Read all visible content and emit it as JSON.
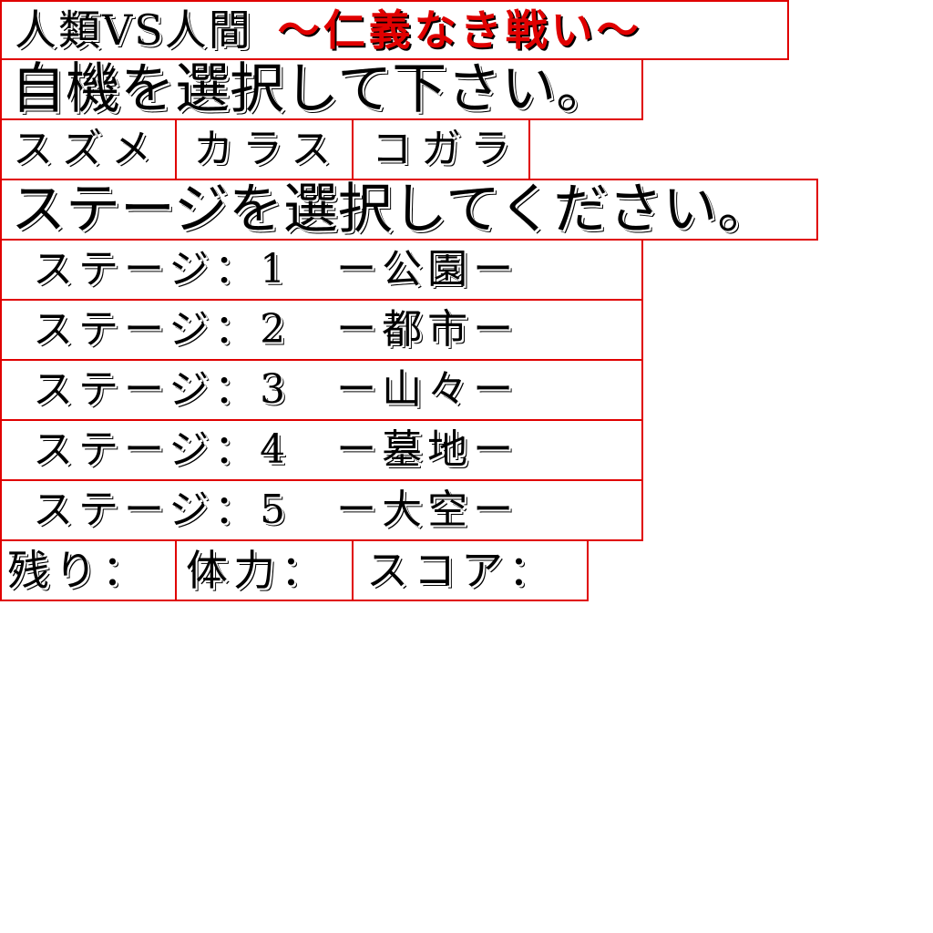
{
  "title": {
    "main": "人類VS人間",
    "sub": "〜仁義なき戦い〜"
  },
  "plane_select": {
    "heading": "自機を選択して下さい。",
    "options": [
      "スズメ",
      "カラス",
      "コガラ"
    ]
  },
  "stage_select": {
    "heading": "ステージを選択してください。",
    "stages": [
      "ステージ：1　ー公園ー",
      "ステージ：2　ー都市ー",
      "ステージ：3　ー山々ー",
      "ステージ：4　ー墓地ー",
      "ステージ：5　ー大空ー"
    ]
  },
  "status": {
    "lives_label": "残り：",
    "health_label": "体力：",
    "score_label": "スコア："
  },
  "colors": {
    "border": "#e00000",
    "subtitle": "#e00000",
    "text": "#000000",
    "background": "#ffffff"
  }
}
